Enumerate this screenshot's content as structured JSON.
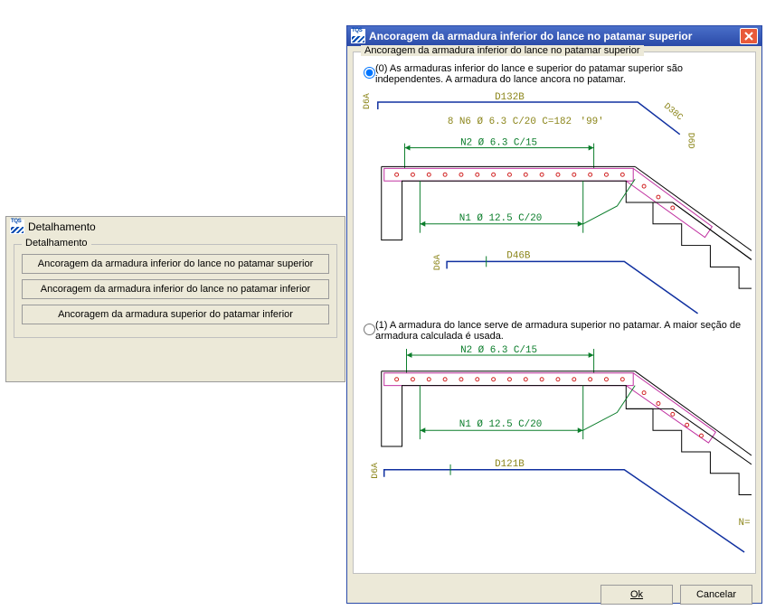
{
  "small_dialog": {
    "title": "Detalhamento",
    "group_legend": "Detalhamento",
    "buttons": [
      "Ancoragem da armadura inferior do lance no patamar superior",
      "Ancoragem da armadura inferior do lance no patamar inferior",
      "Ancoragem da armadura superior do patamar inferior"
    ]
  },
  "main_dialog": {
    "title": "Ancoragem da armadura inferior do lance no patamar superior",
    "group_legend": "Ancoragem da armadura inferior do lance no patamar superior",
    "option0": "(0) As armaduras inferior do lance e superior do patamar superior são independentes. A armadura do lance ancora no patamar.",
    "option1": "(1) A armadura do lance serve de armadura superior no patamar. A maior seção de armadura calculada é usada.",
    "ok": "Ok",
    "cancel": "Cancelar",
    "diagram_labels": {
      "d132b": "D132B",
      "d38c": "D38C",
      "d6d": "D6D",
      "d6a": "D6A",
      "n_spec": "8 N6 Ø 6.3 C/20 C=182",
      "rev": "'99'",
      "n2": "N2 Ø 6.3 C/15",
      "n1": "N1 Ø 12.5 C/20",
      "d46b": "D46B",
      "d121b": "D121B",
      "nend": "N="
    }
  }
}
